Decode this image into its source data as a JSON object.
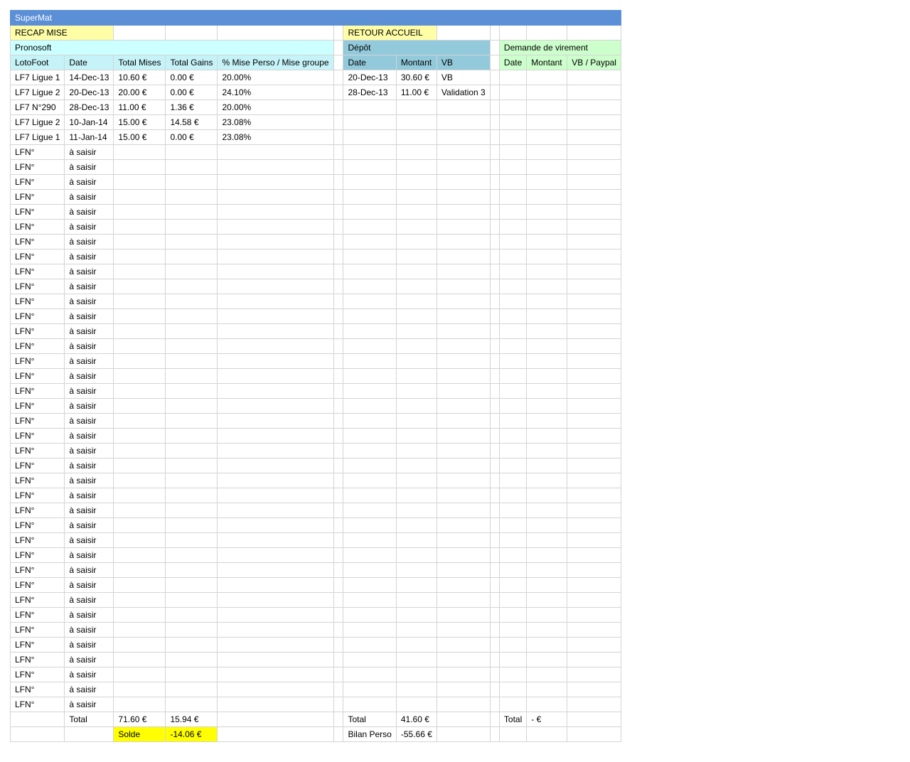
{
  "title": "SuperMat",
  "nav": {
    "recap": "RECAP MISE",
    "retour": "RETOUR ACCUEIL"
  },
  "sections": {
    "pronosoft": "Pronosoft",
    "depot": "Dépôt",
    "virement": "Demande de virement"
  },
  "headers": {
    "pronosoft": [
      "LotoFoot",
      "Date",
      "Total Mises",
      "Total Gains",
      "% Mise Perso / Mise groupe"
    ],
    "depot": [
      "Date",
      "Montant",
      "VB"
    ],
    "virement": [
      "Date",
      "Montant",
      "VB / Paypal"
    ]
  },
  "pronosoft_rows": [
    [
      "LF7 Ligue 1",
      "14-Dec-13",
      "10.60 €",
      "0.00 €",
      "20.00%"
    ],
    [
      "LF7 Ligue 2",
      "20-Dec-13",
      "20.00 €",
      "0.00 €",
      "24.10%"
    ],
    [
      "LF7 N°290",
      "28-Dec-13",
      "11.00 €",
      "1.36 €",
      "20.00%"
    ],
    [
      "LF7 Ligue 2",
      "10-Jan-14",
      "15.00 €",
      "14.58 €",
      "23.08%"
    ],
    [
      "LF7 Ligue 1",
      "11-Jan-14",
      "15.00 €",
      "0.00 €",
      "23.08%"
    ]
  ],
  "placeholder_row": {
    "lotofoot": "LFN°",
    "date": "à saisir",
    "count": 38
  },
  "depot_rows": [
    [
      "20-Dec-13",
      "30.60 €",
      "VB"
    ],
    [
      "28-Dec-13",
      "11.00 €",
      "Validation 3"
    ]
  ],
  "totals": {
    "total_label": "Total",
    "total_mises": "71.60 €",
    "total_gains": "15.94 €",
    "solde_label": "Solde",
    "solde_value": "-14.06 €",
    "depot_total_label": "Total",
    "depot_total": "41.60 €",
    "bilan_label": "Bilan Perso",
    "bilan_value": "-55.66 €",
    "virement_total_label": "Total",
    "virement_total": " - €"
  },
  "colors": {
    "title_bar": "#5b8fd6",
    "yellow_pale": "#fffea6",
    "yellow": "#ffff00",
    "cyan": "#ccffff",
    "depot_header": "#92cadb",
    "virement_header": "#ccffcc"
  }
}
